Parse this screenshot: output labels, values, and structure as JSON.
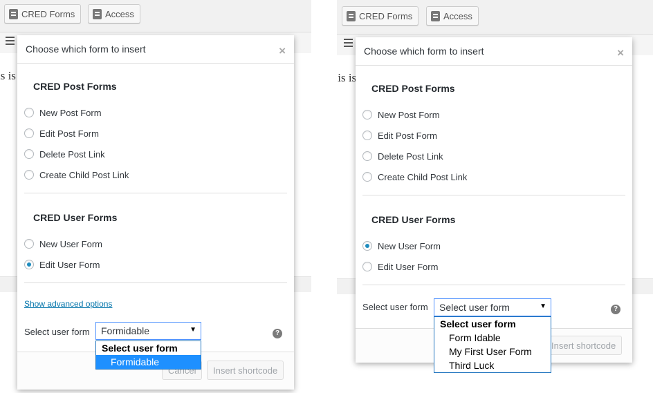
{
  "toolbar": {
    "cred_forms_label": "CRED Forms",
    "access_label": "Access"
  },
  "editor": {
    "text_fragment_left": "is is",
    "text_fragment_right": ".is is"
  },
  "dialog": {
    "title": "Choose which form to insert",
    "close_symbol": "×",
    "post_section_title": "CRED Post Forms",
    "post_options": [
      "New Post Form",
      "Edit Post Form",
      "Delete Post Link",
      "Create Child Post Link"
    ],
    "user_section_title": "CRED User Forms",
    "user_options": [
      "New User Form",
      "Edit User Form"
    ],
    "advanced_link": "Show advanced options",
    "select_label": "Select user form",
    "help_symbol": "?",
    "cancel_label": "Cancel",
    "insert_label": "Insert shortcode"
  },
  "left": {
    "checked_user_option": "Edit User Form",
    "select_value": "Formidable",
    "dropdown_options": [
      {
        "label": "Select user form",
        "group": true,
        "selected": false
      },
      {
        "label": "Formidable",
        "group": false,
        "selected": true
      }
    ]
  },
  "right": {
    "checked_user_option": "New User Form",
    "select_value": "Select user form",
    "dropdown_options": [
      {
        "label": "Select user form",
        "group": true,
        "selected": false
      },
      {
        "label": "Form Idable",
        "group": false,
        "selected": false
      },
      {
        "label": "My First User Form",
        "group": false,
        "selected": false
      },
      {
        "label": "Third Luck",
        "group": false,
        "selected": false
      }
    ]
  },
  "colors": {
    "link": "#0073aa",
    "radio_checked": "#1e8cbe",
    "dropdown_highlight": "#1e90ff",
    "select_focus_border": "#4d90fe"
  },
  "icons": {
    "toolbar_button": "form-icon",
    "editor_align": "align-left-icon",
    "help": "help-circle-icon"
  }
}
